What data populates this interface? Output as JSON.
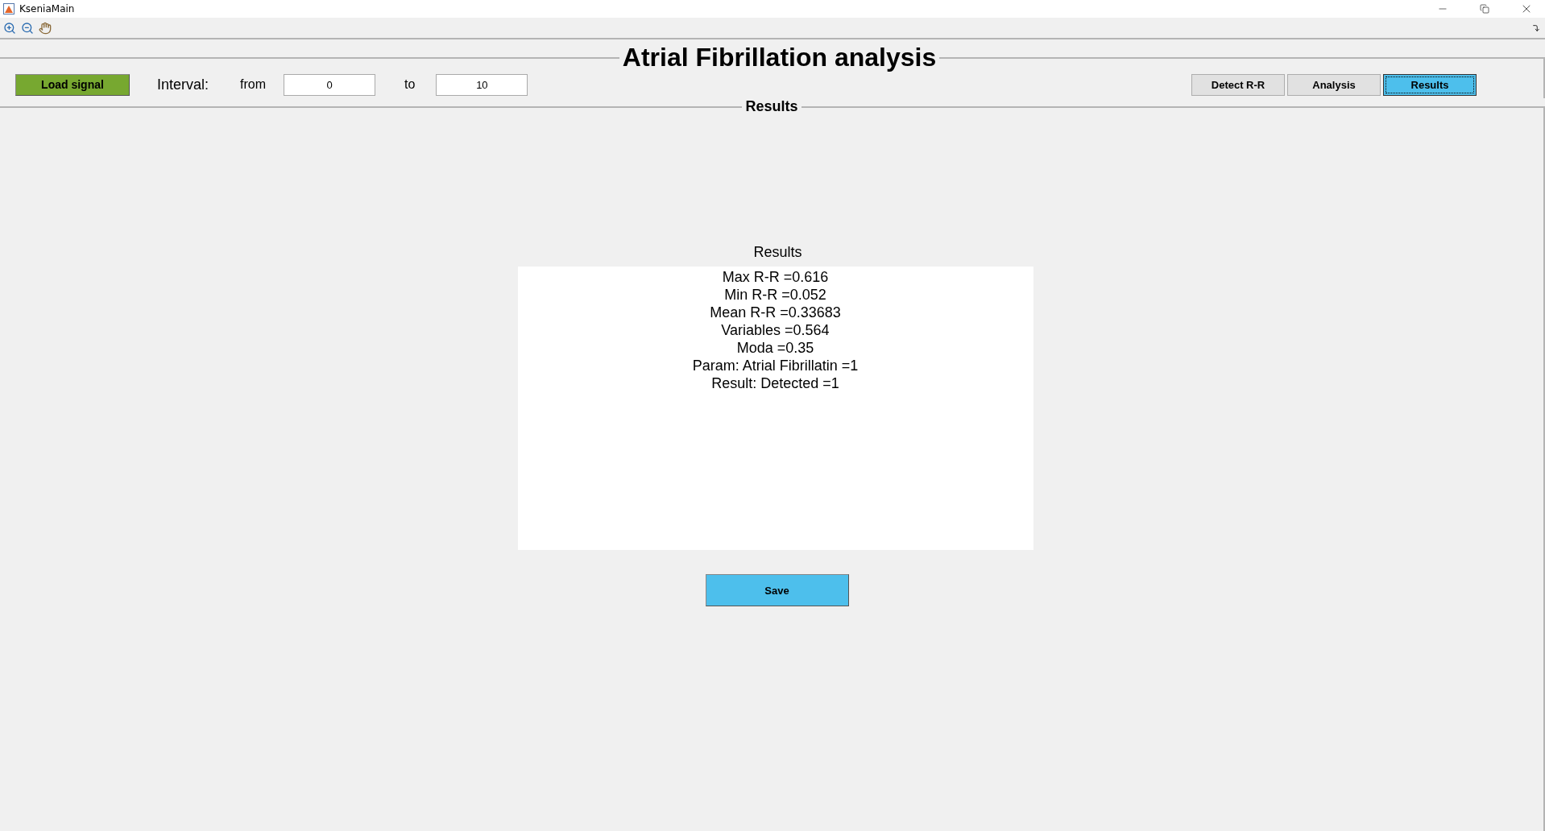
{
  "window": {
    "title": "KseniaMain"
  },
  "header": {
    "title": "Atrial Fibrillation analysis"
  },
  "controls": {
    "load_button": "Load signal",
    "interval_label": "Interval:",
    "from_label": "from",
    "from_value": "0",
    "to_label": "to",
    "to_value": "10"
  },
  "tabs": [
    {
      "label": "Detect R-R",
      "selected": false
    },
    {
      "label": "Analysis",
      "selected": false
    },
    {
      "label": "Results",
      "selected": true
    }
  ],
  "panel": {
    "title": "Results",
    "results_label": "Results",
    "lines": [
      "Max R-R =0.616",
      "Min R-R =0.052",
      "Mean R-R =0.33683",
      "Variables =0.564",
      "Moda =0.35",
      "Param: Atrial Fibrillatin =1",
      "Result: Detected =1"
    ],
    "save_button": "Save"
  }
}
